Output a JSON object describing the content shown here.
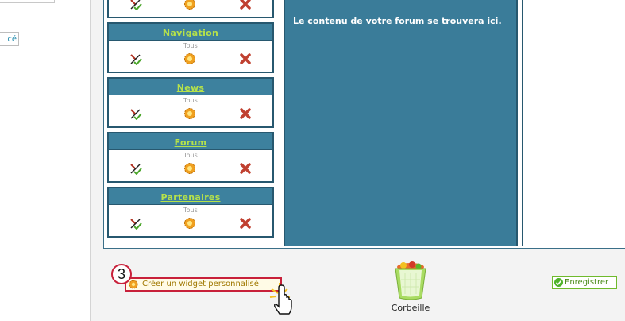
{
  "left_panel": {
    "button_label": "cé"
  },
  "widgets": [
    {
      "title": "",
      "sub": ""
    },
    {
      "title": "Navigation",
      "sub": "Tous"
    },
    {
      "title": "News",
      "sub": "Tous"
    },
    {
      "title": "Forum",
      "sub": "Tous"
    },
    {
      "title": "Partenaires",
      "sub": "Tous"
    }
  ],
  "center": {
    "message": "Le contenu de votre forum se trouvera ici."
  },
  "actions": {
    "step_number": "3",
    "create_label": "Créer un widget personnalisé",
    "trash_label": "Corbeille",
    "save_label": "Enregistrer"
  },
  "colors": {
    "header_blue": "#3d819e",
    "title_green": "#b6e24a",
    "highlight_red": "#c8203a",
    "save_green": "#6fba2c"
  },
  "icons": [
    "edit-icon",
    "gear-icon",
    "delete-icon",
    "trash-icon",
    "hand-cursor-icon",
    "check-icon"
  ]
}
